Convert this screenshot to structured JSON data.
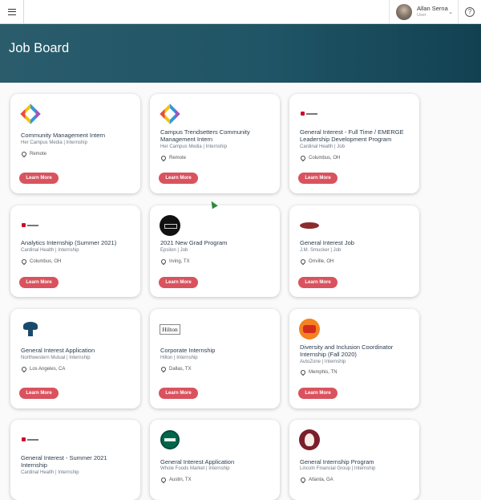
{
  "header": {
    "user_name": "Allan Serna",
    "user_role": "User",
    "help_glyph": "?"
  },
  "banner": {
    "title": "Job Board"
  },
  "jobs": [
    {
      "title": "Community Management Intern",
      "company": "Her Campus Media | Internship",
      "location": "Remote",
      "button": "Learn More",
      "logo": "her-campus-logo"
    },
    {
      "title": "Campus Trendsetters Community Management Intern",
      "company": "Her Campus Media | Internship",
      "location": "Remote",
      "button": "Learn More",
      "logo": "her-campus-logo"
    },
    {
      "title": "General Interest - Full Time / EMERGE Leadership Development Program",
      "company": "Cardinal Health | Job",
      "location": "Columbus, OH",
      "button": "Learn More",
      "logo": "cardinal-health-logo"
    },
    {
      "title": "Analytics Internship (Summer 2021)",
      "company": "Cardinal Health | Internship",
      "location": "Columbus, OH",
      "button": "Learn More",
      "logo": "cardinal-health-logo"
    },
    {
      "title": "2021 New Grad Program",
      "company": "Epsilon | Job",
      "location": "Irving, TX",
      "button": "Learn More",
      "logo": "epsilon-logo"
    },
    {
      "title": "General Interest Job",
      "company": "J.M. Smucker | Job",
      "location": "Orrville, OH",
      "button": "Learn More",
      "logo": "smucker-logo"
    },
    {
      "title": "General Interest Application",
      "company": "Northwestern Mutual | Internship",
      "location": "Los Angeles, CA",
      "button": "Learn More",
      "logo": "northwestern-mutual-logo"
    },
    {
      "title": "Corporate Internship",
      "company": "Hilton | Internship",
      "location": "Dallas, TX",
      "button": "Learn More",
      "logo": "hilton-logo"
    },
    {
      "title": "Diversity and Inclusion Coordinator Internship (Fall 2020)",
      "company": "AutoZone | Internship",
      "location": "Memphis, TN",
      "button": "Learn More",
      "logo": "autozone-logo"
    },
    {
      "title": "General Interest - Summer 2021 Internship",
      "company": "Cardinal Health | Internship",
      "location": "",
      "button": "",
      "logo": "cardinal-health-logo"
    },
    {
      "title": "General Interest Application",
      "company": "Whole Foods Market | Internship",
      "location": "Austin, TX",
      "button": "",
      "logo": "whole-foods-logo"
    },
    {
      "title": "General Internship Program",
      "company": "Lincoln Financial Group | Internship",
      "location": "Atlanta, GA",
      "button": "",
      "logo": "lincoln-financial-logo"
    }
  ],
  "logo_labels": {
    "hilton": "Hilton"
  },
  "colors": {
    "banner": "#1f5566",
    "button": "#d9535e",
    "title_text": "#2a3b4d"
  }
}
